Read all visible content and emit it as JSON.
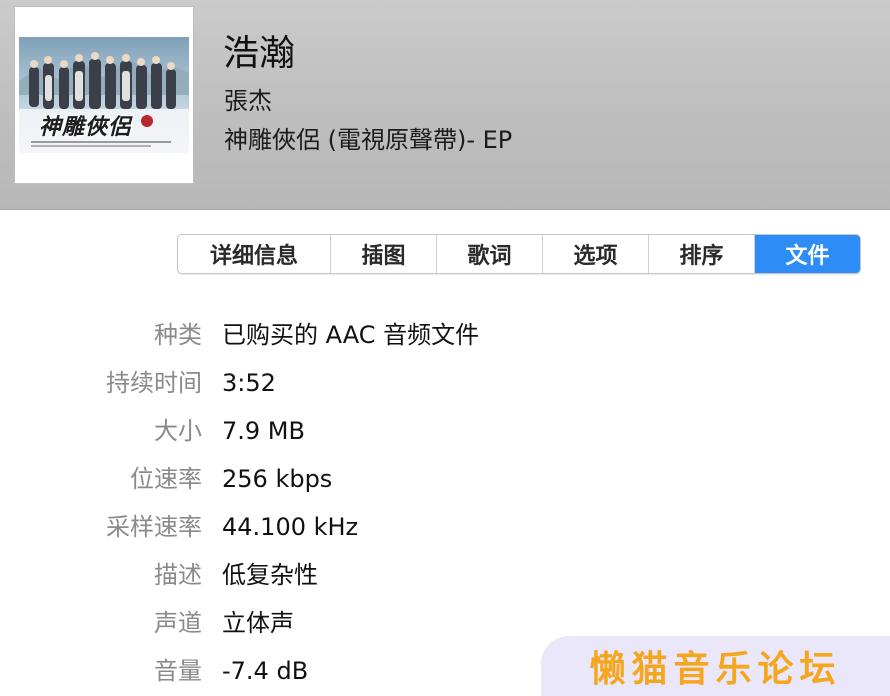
{
  "song": {
    "title": "浩瀚",
    "artist": "張杰",
    "album": "神雕俠侶 (電視原聲帶)- EP",
    "artwork_caption": "神雕俠侶"
  },
  "tabs": [
    {
      "label": "详细信息",
      "active": false
    },
    {
      "label": "插图",
      "active": false
    },
    {
      "label": "歌词",
      "active": false
    },
    {
      "label": "选项",
      "active": false
    },
    {
      "label": "排序",
      "active": false
    },
    {
      "label": "文件",
      "active": true
    }
  ],
  "file_info": [
    {
      "label": "种类",
      "value": "已购买的 AAC 音频文件"
    },
    {
      "label": "持续时间",
      "value": "3:52"
    },
    {
      "label": "大小",
      "value": "7.9 MB"
    },
    {
      "label": "位速率",
      "value": "256 kbps"
    },
    {
      "label": "采样速率",
      "value": "44.100 kHz"
    },
    {
      "label": "描述",
      "value": "低复杂性"
    },
    {
      "label": "声道",
      "value": "立体声"
    },
    {
      "label": "音量",
      "value": "-7.4 dB"
    }
  ],
  "watermark": "懒猫音乐论坛",
  "colors": {
    "accent": "#2d8cf5",
    "label_gray": "#8a8a8a",
    "watermark_text": "#f5a61f",
    "watermark_bg": "#ebe7fb"
  }
}
